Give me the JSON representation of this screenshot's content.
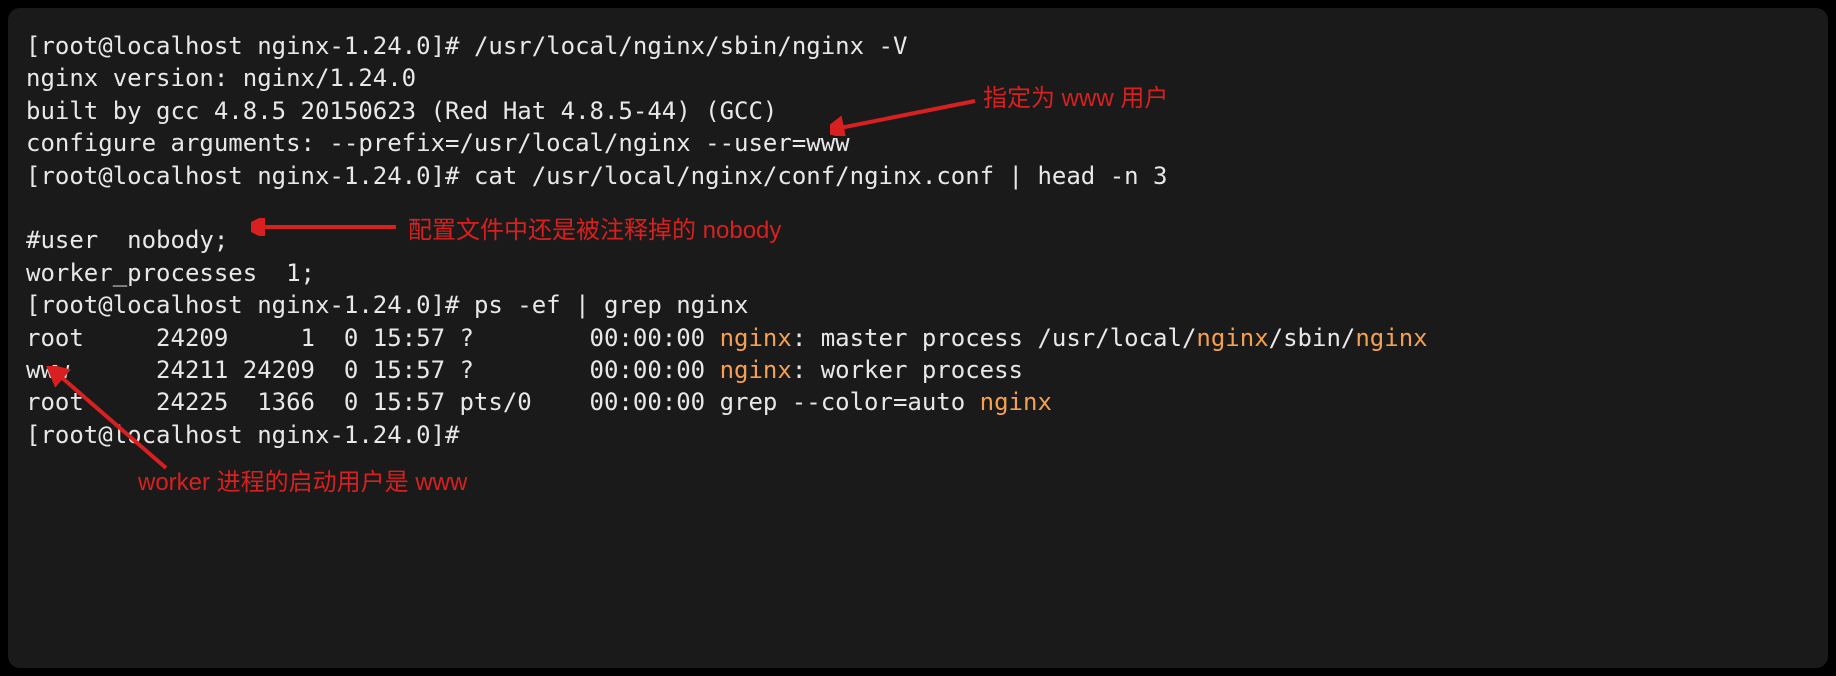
{
  "terminal": {
    "line1_prompt": "[root@localhost nginx-1.24.0]# ",
    "line1_cmd": "/usr/local/nginx/sbin/nginx -V",
    "line2": "nginx version: nginx/1.24.0",
    "line3": "built by gcc 4.8.5 20150623 (Red Hat 4.8.5-44) (GCC)",
    "line4": "configure arguments: --prefix=/usr/local/nginx --user=www",
    "line5_prompt": "[root@localhost nginx-1.24.0]# ",
    "line5_cmd": "cat /usr/local/nginx/conf/nginx.conf | head -n 3",
    "line6": "",
    "line7": "#user  nobody;",
    "line8": "worker_processes  1;",
    "line9_prompt": "[root@localhost nginx-1.24.0]# ",
    "line9_cmd": "ps -ef | grep nginx",
    "ps_row1_pre": "root     24209     1  0 15:57 ?        00:00:00 ",
    "ps_row1_hl1": "nginx",
    "ps_row1_mid1": ": master process /usr/local/",
    "ps_row1_hl2": "nginx",
    "ps_row1_mid2": "/sbin/",
    "ps_row1_hl3": "nginx",
    "ps_row2_pre": "www      24211 24209  0 15:57 ?        00:00:00 ",
    "ps_row2_hl1": "nginx",
    "ps_row2_post": ": worker process",
    "ps_row3_pre": "root     24225  1366  0 15:57 pts/0    00:00:00 grep --color=auto ",
    "ps_row3_hl1": "nginx",
    "line13_prompt": "[root@localhost nginx-1.24.0]# "
  },
  "annotations": {
    "a1": "指定为 www 用户",
    "a2": "配置文件中还是被注释掉的 nobody",
    "a3": "worker 进程的启动用户是 www"
  }
}
